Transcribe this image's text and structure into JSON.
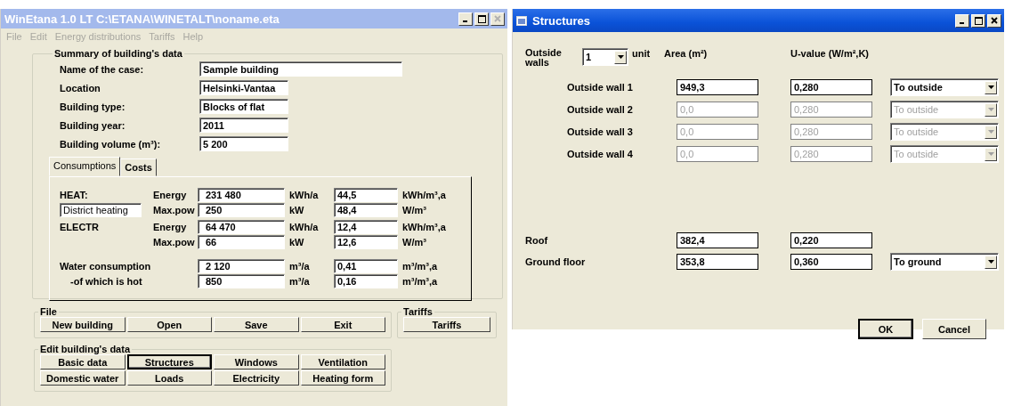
{
  "main_window": {
    "title": "WinEtana 1.0 LT C:\\ETANA\\WINETALT\\noname.eta",
    "active": false,
    "menu": [
      {
        "label": "File",
        "disabled": true
      },
      {
        "label": "Edit",
        "disabled": true
      },
      {
        "label": "Energy distributions",
        "disabled": true
      },
      {
        "label": "Tariffs",
        "disabled": true
      },
      {
        "label": "Help",
        "disabled": true
      }
    ],
    "summary": {
      "title": "Summary of building's data",
      "fields": [
        {
          "label": "Name of the case:",
          "value": "Sample building",
          "kind": "wide"
        },
        {
          "label": "Location",
          "value": "Helsinki-Vantaa",
          "kind": "short"
        },
        {
          "label": "Building type:",
          "value": "Blocks of flat",
          "kind": "short"
        },
        {
          "label": "Building year:",
          "value": "2011",
          "kind": "short"
        },
        {
          "label": "Building volume (m³):",
          "value": "5 200",
          "kind": "short"
        }
      ]
    },
    "tabs": [
      {
        "label": "Consumptions",
        "selected": true
      },
      {
        "label": "Costs",
        "selected": false
      }
    ],
    "consumption_groups": [
      {
        "rows": [
          {
            "kind": "label",
            "heading": "HEAT:",
            "measure": "Energy",
            "value": "231 480",
            "unit": "kWh/a",
            "specific": "44,5",
            "specific_unit": "kWh/m³,a"
          },
          {
            "kind": "field",
            "heading": "District heating",
            "measure": "Max.pow",
            "value": "250",
            "unit": "kW",
            "specific": "48,4",
            "specific_unit": "W/m³"
          }
        ]
      },
      {
        "rows": [
          {
            "kind": "label",
            "heading": "ELECTR",
            "measure": "Energy",
            "value": "64 470",
            "unit": "kWh/a",
            "specific": "12,4",
            "specific_unit": "kWh/m³,a"
          },
          {
            "kind": "blank",
            "measure": "Max.pow",
            "value": "66",
            "unit": "kW",
            "specific": "12,6",
            "specific_unit": "W/m³"
          }
        ]
      },
      {
        "rows": [
          {
            "kind": "wide",
            "heading": "Water consumption",
            "value": "2 120",
            "unit": "m³/a",
            "specific": "0,41",
            "specific_unit": "m³/m³,a"
          },
          {
            "kind": "indented",
            "heading": "-of which is hot",
            "value": "850",
            "unit": "m³/a",
            "specific": "0,16",
            "specific_unit": "m³/m³,a"
          }
        ]
      }
    ],
    "file_group": {
      "title": "File",
      "buttons": [
        {
          "label": "New building",
          "selected": false
        },
        {
          "label": "Open",
          "selected": false
        },
        {
          "label": "Save",
          "selected": false
        },
        {
          "label": "Exit",
          "selected": false
        }
      ]
    },
    "tariffs_group": {
      "title": "Tariffs",
      "buttons": [
        {
          "label": "Tariffs",
          "selected": false
        }
      ]
    },
    "edit_group": {
      "title": "Edit building's data",
      "buttons": [
        {
          "label": "Basic data",
          "selected": false
        },
        {
          "label": "Structures",
          "selected": true
        },
        {
          "label": "Windows",
          "selected": false
        },
        {
          "label": "Ventilation",
          "selected": false
        },
        {
          "label": "Domestic water",
          "selected": false
        },
        {
          "label": "Loads",
          "selected": false
        },
        {
          "label": "Electricity",
          "selected": false
        },
        {
          "label": "Heating form",
          "selected": false
        }
      ]
    }
  },
  "structures_window": {
    "title": "Structures",
    "active": true,
    "outside_walls": {
      "label": "Outside walls",
      "count": "1",
      "units_label": "unit"
    },
    "headers": [
      "Area (m²)",
      "U-value (W/m²,K)"
    ],
    "walls": [
      {
        "label": "Outside wall 1",
        "area": "949,3",
        "u_value": "0,280",
        "boundary": "To outside",
        "disabled": false
      },
      {
        "label": "Outside wall 2",
        "area": "0,0",
        "u_value": "0,280",
        "boundary": "To outside",
        "disabled": true
      },
      {
        "label": "Outside wall 3",
        "area": "0,0",
        "u_value": "0,280",
        "boundary": "To outside",
        "disabled": true
      },
      {
        "label": "Outside wall 4",
        "area": "0,0",
        "u_value": "0,280",
        "boundary": "To outside",
        "disabled": true
      }
    ],
    "other_structures": [
      {
        "label": "Roof",
        "area": "382,4",
        "u_value": "0,220",
        "disabled": false
      },
      {
        "label": "Ground floor",
        "area": "353,8",
        "u_value": "0,360",
        "boundary": "To ground",
        "disabled": false
      }
    ],
    "buttons": [
      {
        "label": "OK",
        "default": true
      },
      {
        "label": "Cancel",
        "default": false
      }
    ]
  }
}
